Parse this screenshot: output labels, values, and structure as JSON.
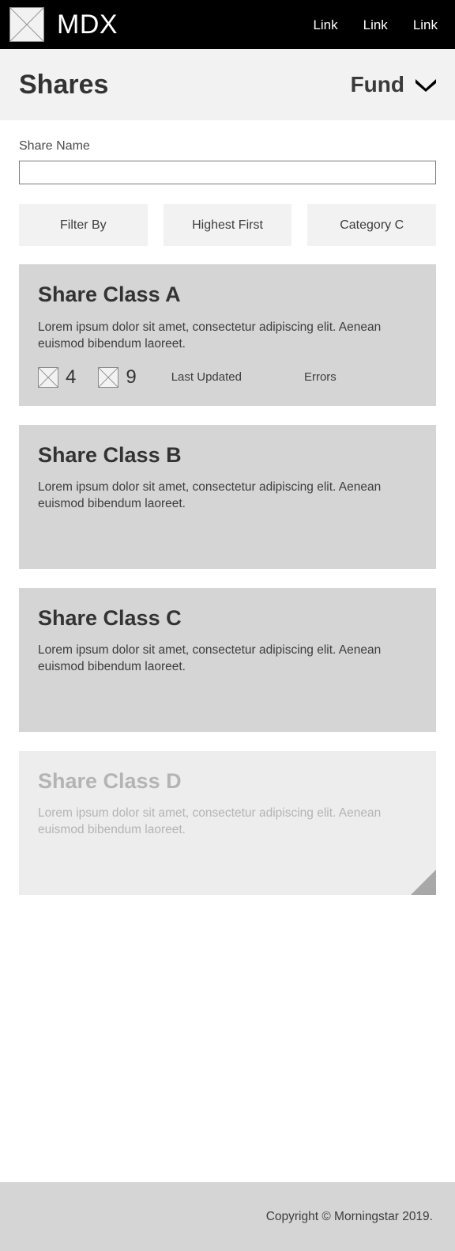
{
  "navbar": {
    "logo_icon": "image-placeholder-icon",
    "brand": "MDX",
    "links": [
      {
        "label": "Link"
      },
      {
        "label": "Link"
      },
      {
        "label": "Link"
      }
    ]
  },
  "page_header": {
    "title": "Shares",
    "fund_selector": {
      "label": "Fund",
      "icon": "chevron-down-icon"
    }
  },
  "search": {
    "label": "Share Name",
    "value": "",
    "placeholder": ""
  },
  "filters": [
    {
      "label": "Filter By"
    },
    {
      "label": "Highest First"
    },
    {
      "label": "Category C"
    }
  ],
  "cards": [
    {
      "title": "Share Class A",
      "description": "Lorem ipsum dolor sit amet, consectetur adipiscing elit. Aenean euismod bibendum laoreet.",
      "disabled": false,
      "has_meta": true,
      "metrics": [
        {
          "icon": "image-placeholder-icon",
          "value": "4"
        },
        {
          "icon": "image-placeholder-icon",
          "value": "9"
        }
      ],
      "last_updated_label": "Last Updated",
      "errors_label": "Errors"
    },
    {
      "title": "Share Class B",
      "description": "Lorem ipsum dolor sit amet, consectetur adipiscing elit. Aenean euismod bibendum laoreet.",
      "disabled": false,
      "has_meta": false
    },
    {
      "title": "Share Class C",
      "description": "Lorem ipsum dolor sit amet, consectetur adipiscing elit. Aenean euismod bibendum laoreet.",
      "disabled": false,
      "has_meta": false
    },
    {
      "title": "Share Class D",
      "description": "Lorem ipsum dolor sit amet, consectetur adipiscing elit. Aenean euismod bibendum laoreet.",
      "disabled": true,
      "has_meta": false,
      "corner_icon": "corner-fold-icon"
    }
  ],
  "footer": {
    "copyright": "Copyright © Morningstar 2019."
  },
  "colors": {
    "navbar_bg": "#000000",
    "header_bg": "#f2f2f2",
    "card_bg": "#d5d5d5",
    "card_disabled_bg": "#ededed",
    "footer_bg": "#d5d5d5",
    "text_primary": "#333333",
    "text_muted": "#b4b4b4"
  }
}
